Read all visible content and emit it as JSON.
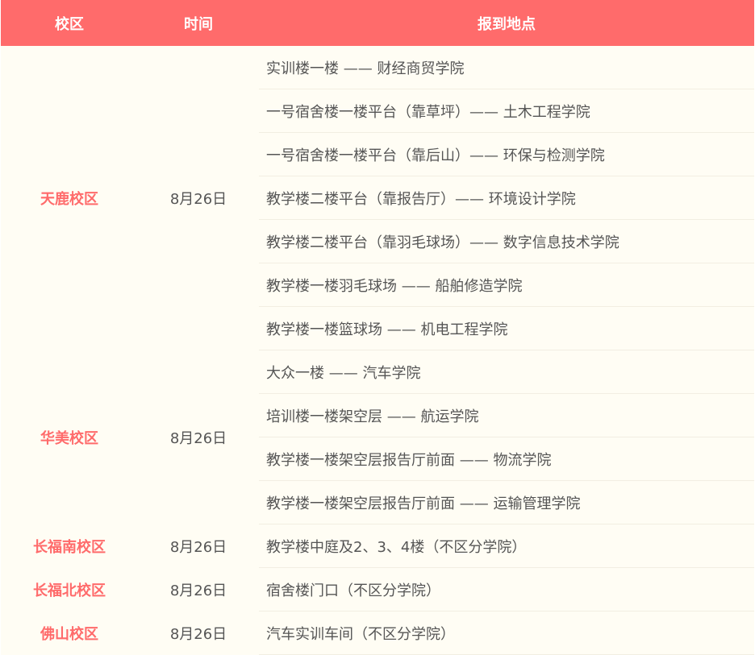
{
  "header": {
    "campus": "校区",
    "time": "时间",
    "place": "报到地点"
  },
  "campuses": [
    {
      "name": "天鹿校区",
      "date": "8月26日",
      "places": [
        "实训楼一楼 —— 财经商贸学院",
        "一号宿舍楼一楼平台（靠草坪）—— 土木工程学院",
        "一号宿舍楼一楼平台（靠后山）—— 环保与检测学院",
        "教学楼二楼平台（靠报告厅）—— 环境设计学院",
        "教学楼二楼平台（靠羽毛球场）—— 数字信息技术学院",
        "教学楼一楼羽毛球场 —— 船舶修造学院",
        "教学楼一楼篮球场 —— 机电工程学院"
      ]
    },
    {
      "name": "华美校区",
      "date": "8月26日",
      "places": [
        "大众一楼 —— 汽车学院",
        "培训楼一楼架空层 —— 航运学院",
        "教学楼一楼架空层报告厅前面 —— 物流学院",
        "教学楼一楼架空层报告厅前面 —— 运输管理学院"
      ]
    },
    {
      "name": "长福南校区",
      "date": "8月26日",
      "places": [
        "教学楼中庭及2、3、4楼（不区分学院）"
      ]
    },
    {
      "name": "长福北校区",
      "date": "8月26日",
      "places": [
        "宿舍楼门口（不区分学院）"
      ]
    },
    {
      "name": "佛山校区",
      "date": "8月26日",
      "places": [
        "汽车实训车间（不区分学院）"
      ]
    }
  ]
}
